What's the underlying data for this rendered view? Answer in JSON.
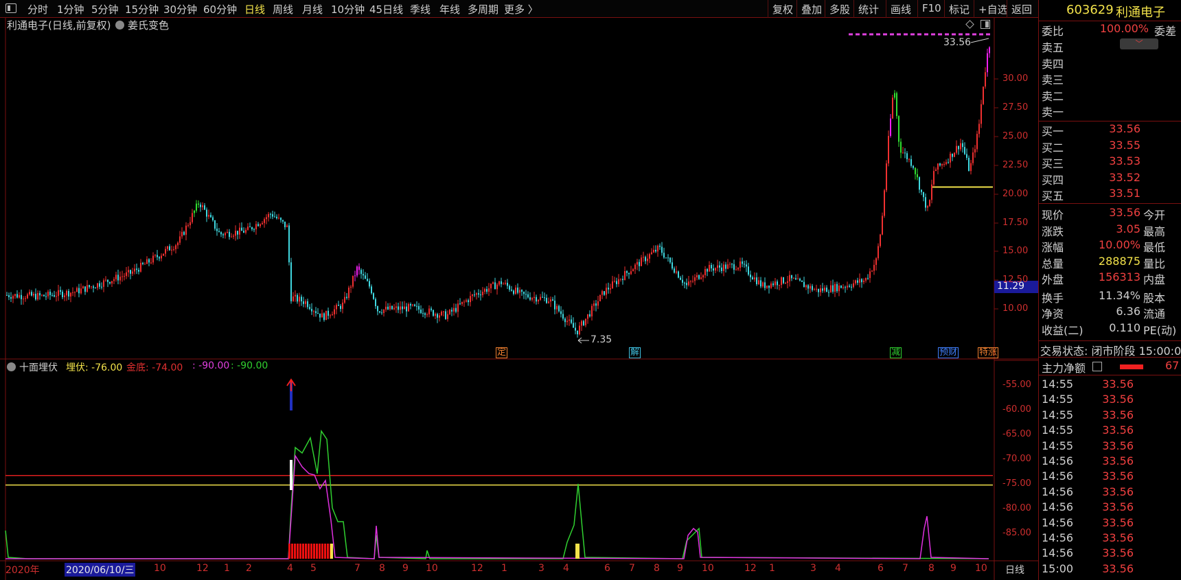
{
  "toolbar": {
    "tabs": [
      "分时",
      "1分钟",
      "5分钟",
      "15分钟",
      "30分钟",
      "60分钟",
      "日线",
      "周线",
      "月线",
      "10分钟",
      "45日线",
      "季线",
      "年线",
      "多周期",
      "更多 〉"
    ],
    "active_tab": "日线",
    "right_tools": [
      "复权",
      "叠加",
      "多股",
      "统计",
      "画线",
      "F10",
      "标记",
      "+自选",
      "返回"
    ]
  },
  "chart_title": {
    "name": "利通电子(日线,前复权)",
    "indicator": "姜氏变色"
  },
  "main_chart": {
    "high_label": "33.56",
    "low_label": "7.35",
    "current_price_badge": "11.29",
    "y_ticks": [
      "30.00",
      "27.50",
      "25.00",
      "22.50",
      "20.00",
      "17.50",
      "15.00",
      "12.50",
      "10.00"
    ],
    "markers": [
      "定",
      "解",
      "减",
      "预财",
      "特涨"
    ]
  },
  "sub_chart": {
    "name": "十面埋伏",
    "legend": [
      {
        "label": "埋伏: -76.00",
        "color": "#f2e24a"
      },
      {
        "label": "金底: -74.00",
        "color": "#e03030"
      },
      {
        "label": ": -90.00",
        "color": "#e040e0"
      },
      {
        "label": ": -90.00",
        "color": "#30d030"
      }
    ],
    "y_ticks": [
      "-55.00",
      "-60.00",
      "-65.00",
      "-70.00",
      "-75.00",
      "-80.00",
      "-85.00"
    ]
  },
  "x_axis": {
    "labels": [
      "2020年",
      "2020/06/10/三",
      "10",
      "12",
      "1",
      "2",
      "4",
      "5",
      "7",
      "8",
      "9",
      "10",
      "12",
      "1",
      "3",
      "4",
      "6",
      "7",
      "8",
      "9",
      "10",
      "12",
      "1",
      "3",
      "4",
      "6",
      "7",
      "8",
      "9",
      "10"
    ],
    "period": "日线"
  },
  "quote": {
    "code": "603629",
    "name": "利通电子",
    "weibi_label": "委比",
    "weibi_value": "100.00%",
    "weicha_label": "委差",
    "sells": [
      {
        "label": "卖五",
        "price": ""
      },
      {
        "label": "卖四",
        "price": ""
      },
      {
        "label": "卖三",
        "price": ""
      },
      {
        "label": "卖二",
        "price": ""
      },
      {
        "label": "卖一",
        "price": ""
      }
    ],
    "buys": [
      {
        "label": "买一",
        "price": "33.56"
      },
      {
        "label": "买二",
        "price": "33.55"
      },
      {
        "label": "买三",
        "price": "33.53"
      },
      {
        "label": "买四",
        "price": "33.52"
      },
      {
        "label": "买五",
        "price": "33.51"
      }
    ],
    "stats": [
      {
        "label": "现价",
        "value": "33.56",
        "label2": "今开",
        "color": "#f04040"
      },
      {
        "label": "涨跌",
        "value": "3.05",
        "label2": "最高",
        "color": "#f04040"
      },
      {
        "label": "涨幅",
        "value": "10.00%",
        "label2": "最低",
        "color": "#f04040"
      },
      {
        "label": "总量",
        "value": "288875",
        "label2": "量比",
        "color": "#f2e24a"
      },
      {
        "label": "外盘",
        "value": "156313",
        "label2": "内盘",
        "color": "#f04040"
      },
      {
        "label": "换手",
        "value": "11.34%",
        "label2": "股本",
        "color": "#d0d0d0"
      },
      {
        "label": "净资",
        "value": "6.36",
        "label2": "流通",
        "color": "#d0d0d0"
      },
      {
        "label": "收益(二)",
        "value": "0.110",
        "label2": "PE(动)",
        "color": "#d0d0d0"
      }
    ],
    "trade_status": "交易状态: 闭市阶段 15:00:0",
    "main_net_label": "主力净额",
    "main_net_value": "67",
    "ticks": [
      {
        "time": "14:55",
        "price": "33.56"
      },
      {
        "time": "14:55",
        "price": "33.56"
      },
      {
        "time": "14:55",
        "price": "33.56"
      },
      {
        "time": "14:55",
        "price": "33.56"
      },
      {
        "time": "14:55",
        "price": "33.56"
      },
      {
        "time": "14:56",
        "price": "33.56"
      },
      {
        "time": "14:56",
        "price": "33.56"
      },
      {
        "time": "14:56",
        "price": "33.56"
      },
      {
        "time": "14:56",
        "price": "33.56"
      },
      {
        "time": "14:56",
        "price": "33.56"
      },
      {
        "time": "14:56",
        "price": "33.56"
      },
      {
        "time": "14:56",
        "price": "33.56"
      },
      {
        "time": "15:00",
        "price": "33.56"
      }
    ]
  }
}
